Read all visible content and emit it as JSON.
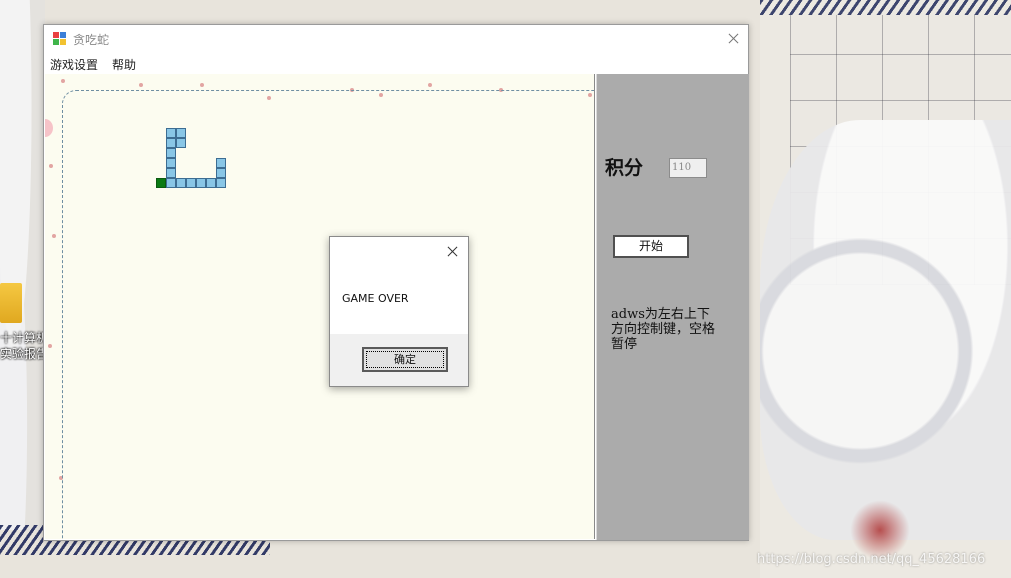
{
  "window": {
    "title": "贪吃蛇",
    "menu": [
      "游戏设置",
      "帮助"
    ]
  },
  "side_panel": {
    "score_label": "积分",
    "score_value": "110",
    "start_button": "开始",
    "help_text": "adws为左右上下方向控制键，空格暂停"
  },
  "dialog": {
    "message": "GAME OVER",
    "ok_button": "确定"
  },
  "desktop": {
    "icon_label_line1": "十计算机",
    "icon_label_line2": "实验报告",
    "watermark": "https://blog.csdn.net/qq_45628166"
  },
  "colors": {
    "snake_body": "#89c6e6",
    "snake_head": "#0b7a13",
    "game_background": "#fcfcf0",
    "side_panel": "#ababab"
  }
}
